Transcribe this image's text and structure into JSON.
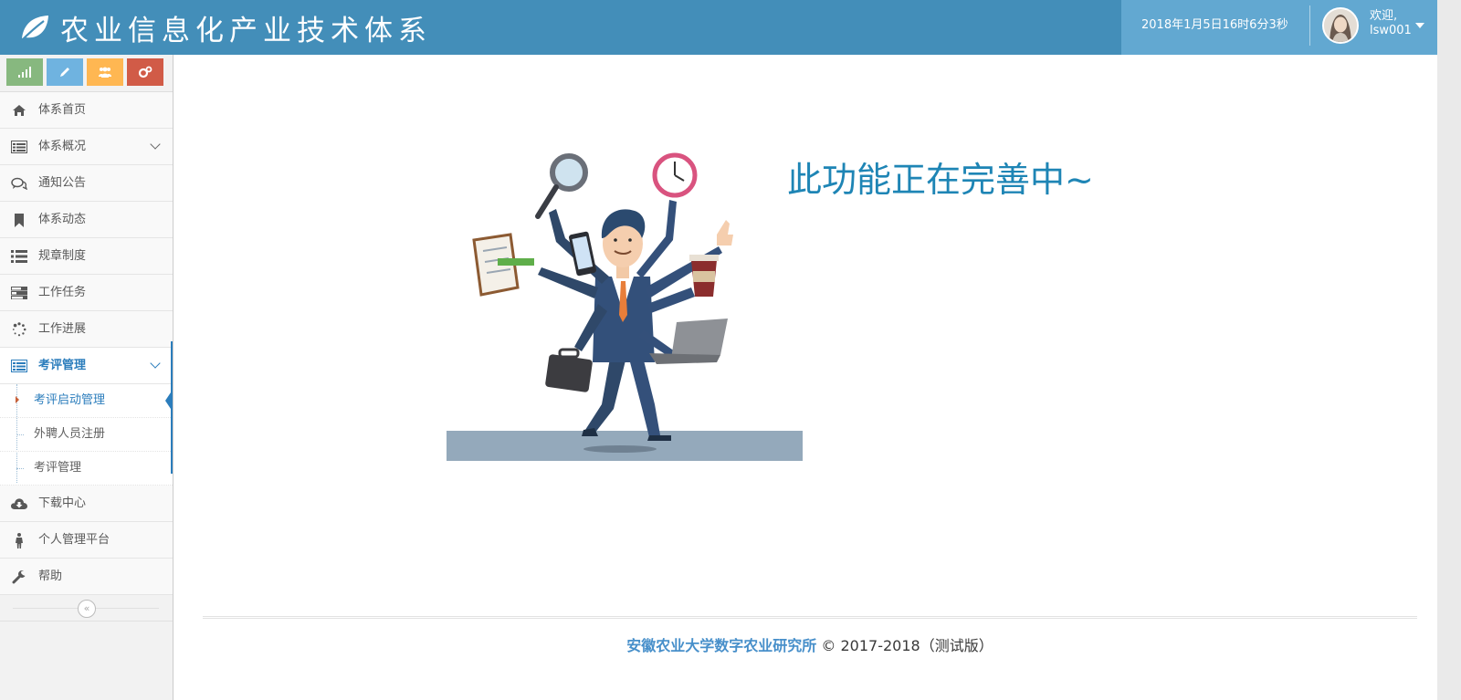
{
  "app": {
    "title": "农业信息化产业技术体系",
    "logo_icon": "leaf-icon"
  },
  "header": {
    "datetime": "2018年1月5日16时6分3秒",
    "welcome": "欢迎,",
    "username": "lsw001",
    "nav_color": "#438eb9",
    "user_area_color": "#62a8d1"
  },
  "shortcuts": [
    {
      "icon": "signal-icon",
      "color": "#87b87f"
    },
    {
      "icon": "pencil-icon",
      "color": "#6fb3e0"
    },
    {
      "icon": "users-icon",
      "color": "#ffb752"
    },
    {
      "icon": "cogs-icon",
      "color": "#d15b47"
    }
  ],
  "sidebar": {
    "items": [
      {
        "label": "体系首页",
        "icon": "home-icon"
      },
      {
        "label": "体系概况",
        "icon": "list-alt-icon",
        "expandable": true
      },
      {
        "label": "通知公告",
        "icon": "comments-icon"
      },
      {
        "label": "体系动态",
        "icon": "bookmark-icon"
      },
      {
        "label": "规章制度",
        "icon": "list-icon"
      },
      {
        "label": "工作任务",
        "icon": "tasks-icon"
      },
      {
        "label": "工作进展",
        "icon": "spinner-icon"
      },
      {
        "label": "考评管理",
        "icon": "list-alt-icon",
        "expandable": true,
        "active": true
      },
      {
        "label": "下载中心",
        "icon": "cloud-download-icon"
      },
      {
        "label": "个人管理平台",
        "icon": "male-icon"
      },
      {
        "label": "帮助",
        "icon": "wrench-icon"
      }
    ],
    "submenu": [
      {
        "label": "考评启动管理",
        "current": true
      },
      {
        "label": "外聘人员注册"
      },
      {
        "label": "考评管理"
      }
    ],
    "collapse_icon": "double-left-icon"
  },
  "main": {
    "message": "此功能正在完善中~",
    "illustration": "busy-businessman-illustration"
  },
  "footer": {
    "org": "安徽农业大学数字农业研究所",
    "copyright": "© 2017-2018（测试版）"
  }
}
